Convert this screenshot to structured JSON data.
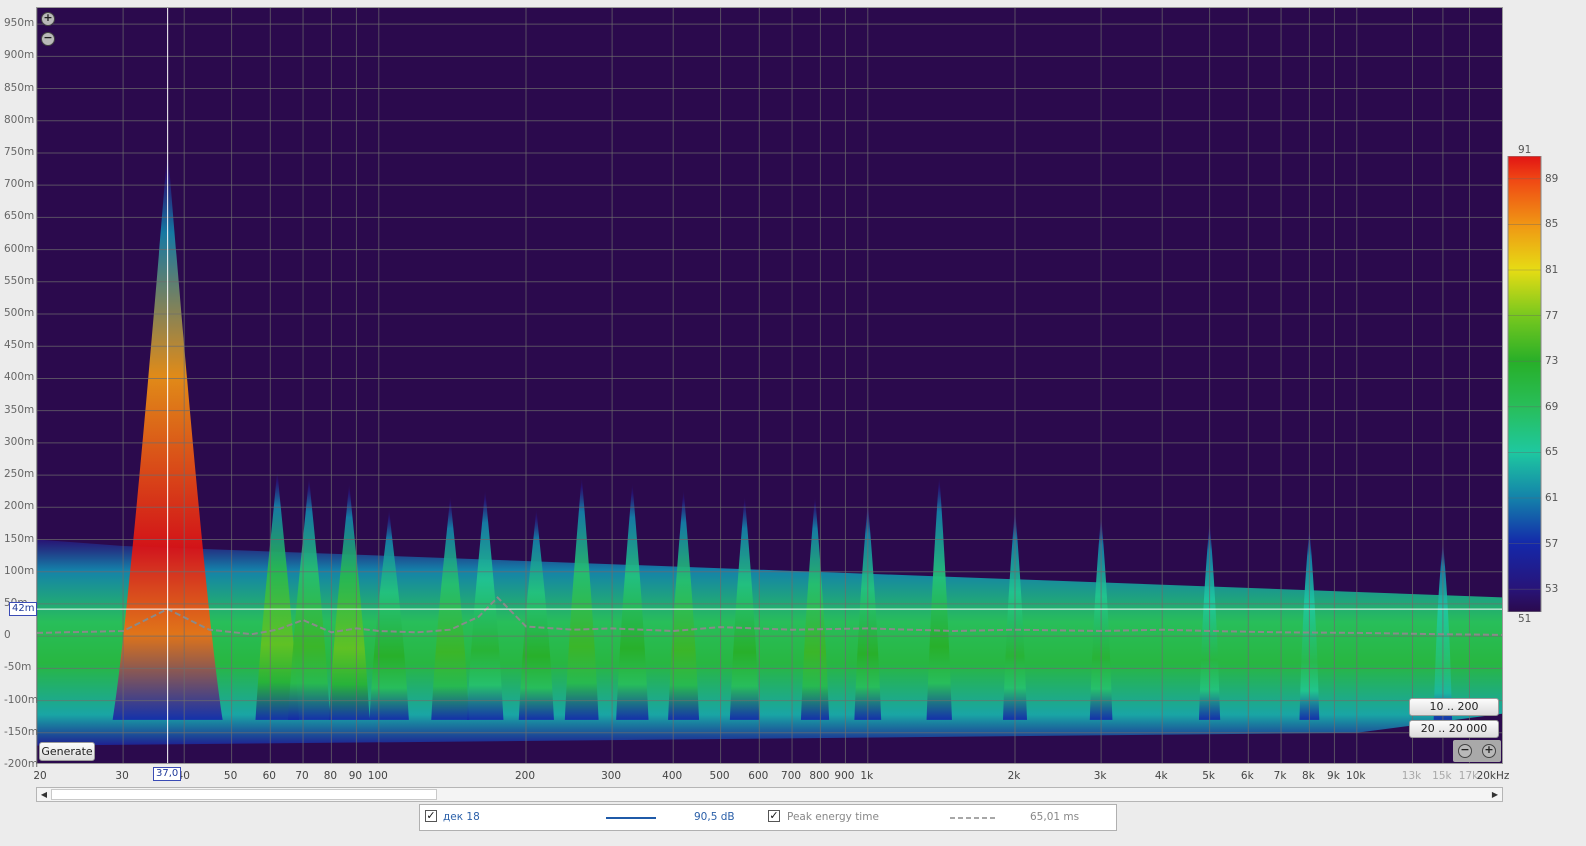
{
  "chart_data": {
    "type": "heatmap",
    "title": "",
    "x_axis": {
      "scale": "log",
      "range": [
        20,
        20000
      ],
      "tick_labels": [
        "20",
        "30",
        "40",
        "50",
        "60",
        "70",
        "80",
        "90",
        "100",
        "200",
        "300",
        "400",
        "500",
        "600",
        "700",
        "800",
        "900",
        "1k",
        "2k",
        "3k",
        "4k",
        "5k",
        "6k",
        "7k",
        "8k",
        "9k",
        "10k",
        "13k",
        "15k",
        "17k",
        "20kHz"
      ],
      "tick_values": [
        20,
        30,
        40,
        50,
        60,
        70,
        80,
        90,
        100,
        200,
        300,
        400,
        500,
        600,
        700,
        800,
        900,
        1000,
        2000,
        3000,
        4000,
        5000,
        6000,
        7000,
        8000,
        9000,
        10000,
        13000,
        15000,
        17000,
        20000
      ]
    },
    "y_axis": {
      "unit": "ms",
      "range": [
        -200,
        975
      ],
      "tick_labels": [
        "950m",
        "900m",
        "850m",
        "800m",
        "750m",
        "700m",
        "650m",
        "600m",
        "550m",
        "500m",
        "450m",
        "400m",
        "350m",
        "300m",
        "250m",
        "200m",
        "150m",
        "100m",
        "50m",
        "0",
        "-50m",
        "-100m",
        "-150m",
        "-200m"
      ],
      "tick_values": [
        950,
        900,
        850,
        800,
        750,
        700,
        650,
        600,
        550,
        500,
        450,
        400,
        350,
        300,
        250,
        200,
        150,
        100,
        50,
        0,
        -50,
        -100,
        -150,
        -200
      ]
    },
    "color_scale": {
      "unit": "dB",
      "min_label": "51",
      "max_label": "91",
      "tick_labels": [
        "89",
        "85",
        "81",
        "77",
        "73",
        "69",
        "65",
        "61",
        "57",
        "53"
      ],
      "tick_values": [
        89,
        85,
        81,
        77,
        73,
        69,
        65,
        61,
        57,
        53
      ]
    },
    "peak_ridges": [
      {
        "freq": 37,
        "time_ms": 760,
        "level_db": 91
      },
      {
        "freq": 62,
        "time_ms": 260,
        "level_db": 76
      },
      {
        "freq": 72,
        "time_ms": 250,
        "level_db": 74
      },
      {
        "freq": 87,
        "time_ms": 240,
        "level_db": 76
      },
      {
        "freq": 105,
        "time_ms": 200,
        "level_db": 73
      },
      {
        "freq": 140,
        "time_ms": 220,
        "level_db": 74
      },
      {
        "freq": 165,
        "time_ms": 230,
        "level_db": 72
      },
      {
        "freq": 210,
        "time_ms": 200,
        "level_db": 73
      },
      {
        "freq": 260,
        "time_ms": 250,
        "level_db": 74
      },
      {
        "freq": 330,
        "time_ms": 240,
        "level_db": 73
      },
      {
        "freq": 420,
        "time_ms": 230,
        "level_db": 74
      },
      {
        "freq": 560,
        "time_ms": 220,
        "level_db": 73
      },
      {
        "freq": 780,
        "time_ms": 220,
        "level_db": 74
      },
      {
        "freq": 1000,
        "time_ms": 210,
        "level_db": 73
      },
      {
        "freq": 1400,
        "time_ms": 250,
        "level_db": 73
      },
      {
        "freq": 2000,
        "time_ms": 200,
        "level_db": 72
      },
      {
        "freq": 3000,
        "time_ms": 190,
        "level_db": 72
      },
      {
        "freq": 5000,
        "time_ms": 180,
        "level_db": 71
      },
      {
        "freq": 8000,
        "time_ms": 170,
        "level_db": 70
      },
      {
        "freq": 15000,
        "time_ms": 150,
        "level_db": 68
      }
    ],
    "peak_energy_time": {
      "freqs": [
        20,
        30,
        37,
        45,
        55,
        62,
        70,
        80,
        90,
        100,
        120,
        140,
        160,
        175,
        200,
        250,
        300,
        400,
        500,
        700,
        1000,
        1500,
        2000,
        3000,
        4000,
        5000,
        7000,
        10000,
        15000,
        20000
      ],
      "time_ms": [
        5,
        8,
        42,
        10,
        3,
        10,
        25,
        6,
        12,
        8,
        6,
        10,
        30,
        60,
        15,
        10,
        12,
        8,
        14,
        10,
        12,
        8,
        10,
        8,
        10,
        8,
        6,
        5,
        3,
        2
      ]
    },
    "cursor": {
      "freq_label": "37,0",
      "time_label": "42m"
    }
  },
  "colors": {
    "background": "#2b0a4d",
    "gridline": "#6d6d6d",
    "cursor": "#ffffff",
    "peak_line": "#8a8a8a",
    "legend_line": "#1f5aa8"
  },
  "ui": {
    "generate_label": "Generate",
    "range_low_label": "10 .. 200",
    "range_full_label": "20 .. 20 000"
  },
  "legend": {
    "measurement_name": "дек 18",
    "measurement_value": "90,5 dB",
    "measurement_checked": true,
    "peak_label": "Peak energy time",
    "peak_value": "65,01 ms",
    "peak_checked": true
  }
}
